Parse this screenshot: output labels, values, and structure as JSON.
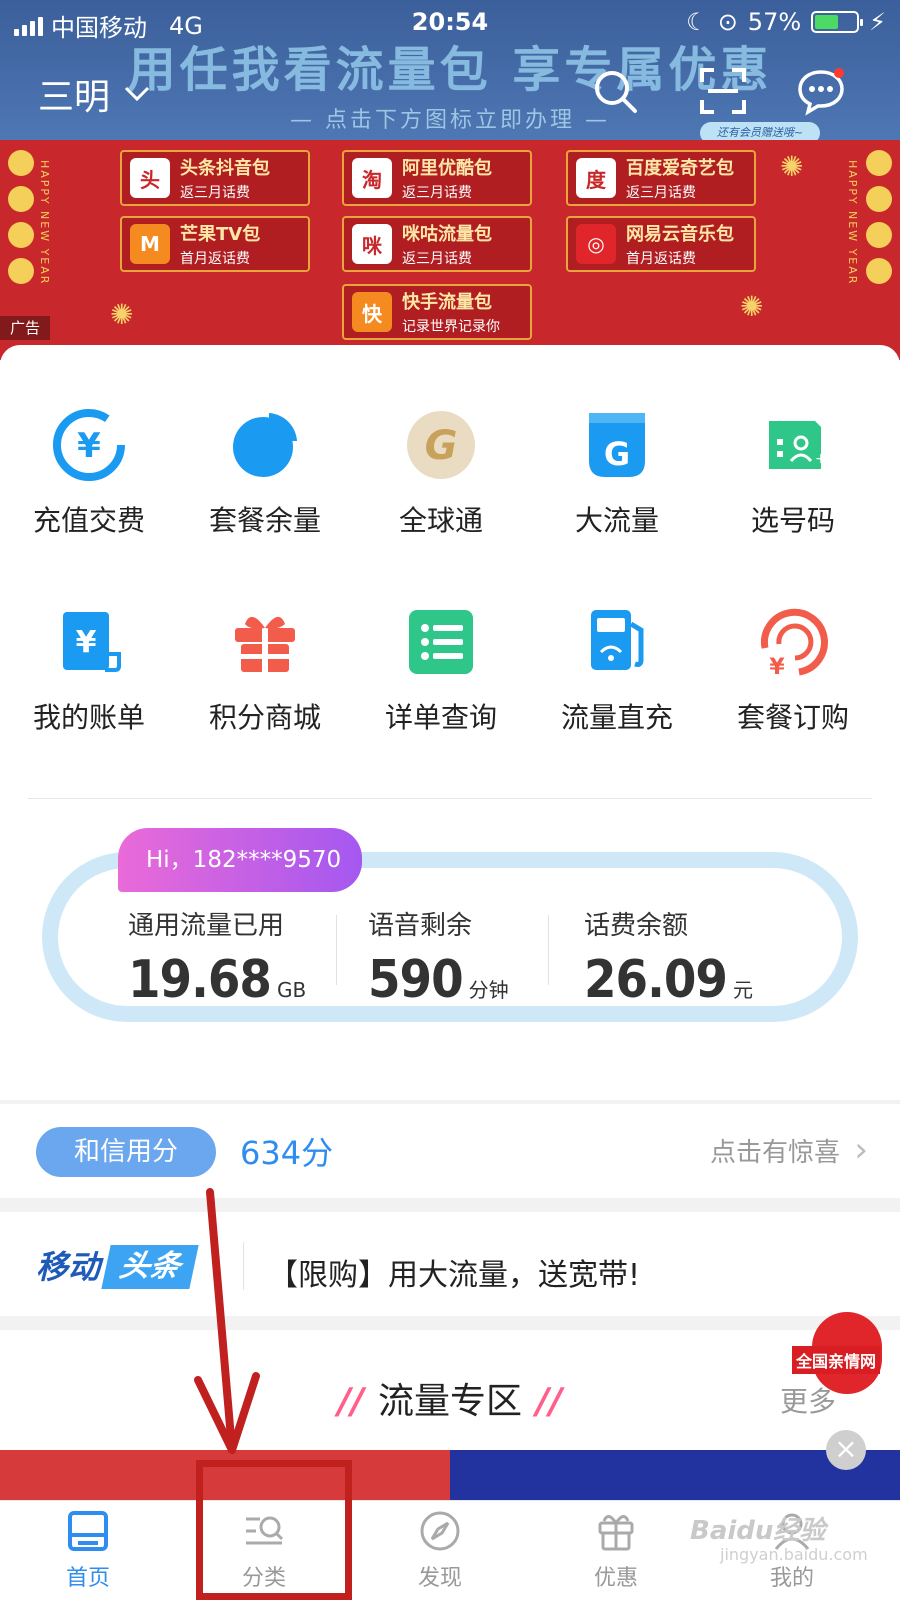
{
  "status_bar": {
    "carrier": "中国移动",
    "network": "4G",
    "time": "20:54",
    "battery": "57%"
  },
  "header": {
    "city": "三明",
    "ad_headline": "用任我看流量包  享专属优惠",
    "ad_subline": "— 点击下方图标立即办理 —",
    "member_tag": "还有会员赠送哦~",
    "search_icon": "search-icon",
    "scan_icon": "scan-icon",
    "message_icon": "message-icon"
  },
  "ad_banner": {
    "label": "广告",
    "side_text": "HAPPY NEW YEAR",
    "packages": [
      {
        "title": "头条抖音包",
        "sub": "返三月话费",
        "icon": "头"
      },
      {
        "title": "阿里优酷包",
        "sub": "返三月话费",
        "icon": "淘"
      },
      {
        "title": "百度爱奇艺包",
        "sub": "返三月话费",
        "icon": "度"
      },
      {
        "title": "芒果TV包",
        "sub": "首月返话费",
        "icon": "M"
      },
      {
        "title": "咪咕流量包",
        "sub": "返三月话费",
        "icon": "咪"
      },
      {
        "title": "网易云音乐包",
        "sub": "首月返话费",
        "icon": "◎"
      },
      {
        "title": "快手流量包",
        "sub": "记录世界记录你",
        "icon": "快"
      }
    ]
  },
  "services": [
    {
      "label": "充值交费",
      "icon": "yuan-recharge-icon",
      "color": "#1a9af0"
    },
    {
      "label": "套餐余量",
      "icon": "pie-chart-icon",
      "color": "#1a9af0"
    },
    {
      "label": "全球通",
      "icon": "global-pass-icon",
      "color": "#c8a25a"
    },
    {
      "label": "大流量",
      "icon": "big-data-icon",
      "color": "#1a9af0"
    },
    {
      "label": "选号码",
      "icon": "sim-card-icon",
      "color": "#2fc68a"
    },
    {
      "label": "我的账单",
      "icon": "bill-icon",
      "color": "#1a9af0"
    },
    {
      "label": "积分商城",
      "icon": "gift-icon",
      "color": "#f25c4a"
    },
    {
      "label": "详单查询",
      "icon": "list-icon",
      "color": "#2fc68a"
    },
    {
      "label": "流量直充",
      "icon": "fuel-wifi-icon",
      "color": "#1a9af0"
    },
    {
      "label": "套餐订购",
      "icon": "yuan-order-icon",
      "color": "#f25c4a"
    }
  ],
  "usage": {
    "greeting": "Hi，182****9570",
    "data": {
      "label": "通用流量已用",
      "value": "19.68",
      "unit": "GB"
    },
    "voice": {
      "label": "语音剩余",
      "value": "590",
      "unit": "分钟"
    },
    "balance": {
      "label": "话费余额",
      "value": "26.09",
      "unit": "元"
    }
  },
  "credit": {
    "label": "和信用分",
    "value": "634分",
    "link": "点击有惊喜"
  },
  "news": {
    "logo_a": "移动",
    "logo_b": "头条",
    "text": "【限购】用大流量，送宽带!"
  },
  "zone": {
    "title": "流量专区",
    "more": "更多",
    "lantern": "全国亲情网"
  },
  "tabs": [
    {
      "label": "首页",
      "icon": "home-icon",
      "active": true
    },
    {
      "label": "分类",
      "icon": "category-search-icon",
      "active": false
    },
    {
      "label": "发现",
      "icon": "compass-icon",
      "active": false
    },
    {
      "label": "优惠",
      "icon": "gift-box-icon",
      "active": false
    },
    {
      "label": "我的",
      "icon": "user-icon",
      "active": false
    }
  ],
  "watermark": {
    "text": "Baidu经验",
    "sub": "jingyan.baidu.com"
  },
  "colors": {
    "accent": "#2f8cf0",
    "annotation": "#c0201e",
    "banner_red": "#c8282b",
    "header_blue": "#4e77b4"
  }
}
